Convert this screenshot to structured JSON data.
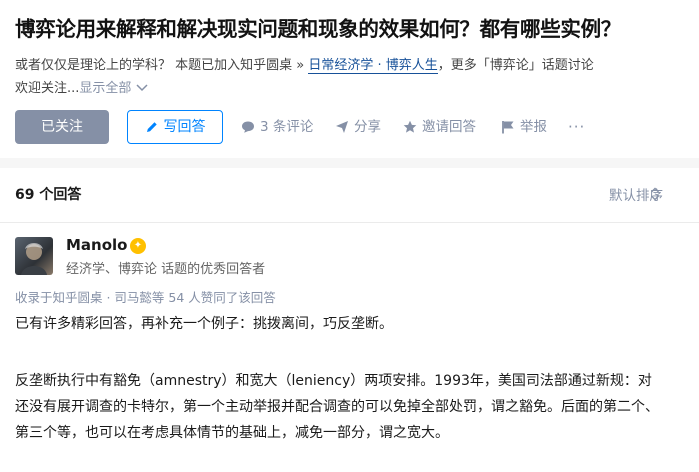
{
  "question": {
    "title": "博弈论用来解释和解决现实问题和现象的效果如何？都有哪些实例？",
    "desc_part1": "或者仅仅是理论上的学科？ 本题已加入知乎圆桌 » ",
    "desc_link": "日常经济学 · 博弈人生",
    "desc_part2": "，更多「博弈论」话题讨论",
    "desc_part3": "欢迎关注...",
    "show_all": "显示全部"
  },
  "actions": {
    "followed": "已关注",
    "write_answer": "写回答",
    "comments": "3 条评论",
    "share": "分享",
    "invite": "邀请回答",
    "report": "举报",
    "more": "···"
  },
  "answers": {
    "count_label": "69 个回答",
    "sort_label": "默认排序"
  },
  "answer": {
    "author": "Manolo",
    "headline": "经济学、博弈论 话题的优秀回答者",
    "voters": "收录于知乎圆桌 · 司马懿等 54 人赞同了该回答",
    "paragraphs": [
      "已有许多精彩回答，再补充一个例子：挑拨离间，巧反垄断。",
      "反垄断执行中有豁免（amnestry）和宽大（leniency）两项安排。1993年，美国司法部通过新规：对还没有展开调查的卡特尔，第一个主动举报并配合调查的可以免掉全部处罚，谓之豁免。后面的第二个、第三个等，也可以在考虑具体情节的基础上，减免一部分，谓之宽大。"
    ]
  },
  "colors": {
    "accent": "#0084ff",
    "muted": "#8590a6",
    "badge": "#ffc000",
    "link": "#175199"
  }
}
